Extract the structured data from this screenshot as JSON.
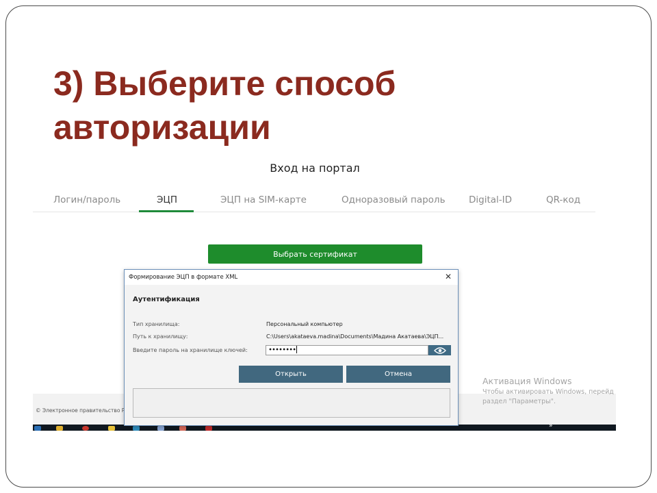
{
  "slide": {
    "title_line1": "3) Выберите способ",
    "title_line2": "авторизации",
    "title_color": "#8b2a1f"
  },
  "portal": {
    "title": "Вход на портал",
    "tabs": [
      "Логин/пароль",
      "ЭЦП",
      "ЭЦП на SIM-карте",
      "Одноразовый пароль",
      "Digital-ID",
      "QR-код"
    ],
    "active_tab": "ЭЦП",
    "select_certificate_button": "Выбрать сертификат",
    "footer_copyright": "© Электронное правительство Ре",
    "accent_color": "#1e8c2c"
  },
  "dialog": {
    "window_title": "Формирование ЭЦП в формате XML",
    "close_icon": "close-icon",
    "heading": "Аутентификация",
    "storage_type_label": "Тип хранилища:",
    "storage_type_value": "Персональный компьютер",
    "storage_path_label": "Путь к хранилищу:",
    "storage_path_value": "C:\\Users\\akataeva.madina\\Documents\\Мадина Акатаева\\ЭЦП...",
    "password_label": "Введите пароль на хранилище ключей:",
    "password_value": "••••••••",
    "show_password_icon": "eye-icon",
    "open_button": "Открыть",
    "cancel_button": "Отмена",
    "button_color": "#41687f"
  },
  "activation_watermark": {
    "title": "Активация Windows",
    "line1": "Чтобы активировать Windows, перейд",
    "line2": "раздел \"Параметры\"."
  },
  "taskbar": {
    "overflow_icon": "chevron-double-up-icon"
  }
}
